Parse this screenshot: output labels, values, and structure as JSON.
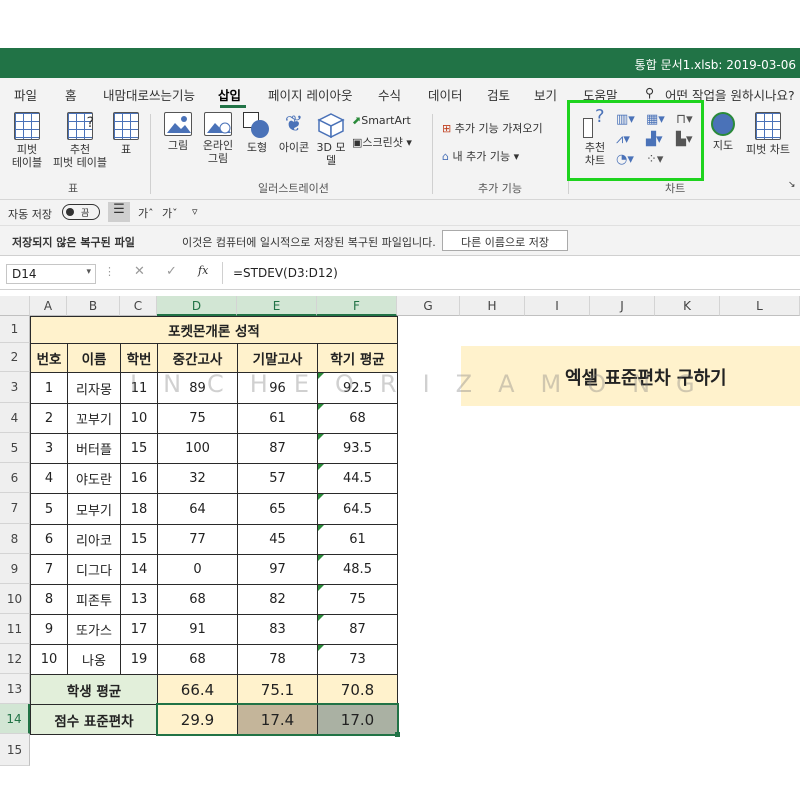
{
  "window": {
    "title": "통합 문서1.xlsb: 2019-03-06"
  },
  "menu": {
    "tabs": [
      "파일",
      "홈",
      "내맘대로쓰는기능",
      "삽입",
      "페이지 레이아웃",
      "수식",
      "데이터",
      "검토",
      "보기",
      "도움말"
    ],
    "active": "삽입",
    "search": "어떤 작업을 원하시나요?"
  },
  "ribbon": {
    "tables": {
      "pivot": "피벗\n테이블",
      "recommended_pivot": "추천\n피벗 테이블",
      "table": "표",
      "group": "표"
    },
    "illustrations": {
      "picture": "그림",
      "online_picture": "온라인\n그림",
      "shapes": "도형",
      "icons": "아이콘",
      "models3d": "3D 모\n델",
      "smartart": "SmartArt",
      "screenshot": "스크린샷",
      "group": "일러스트레이션"
    },
    "addins": {
      "get": "추가 기능 가져오기",
      "my": "내 추가 기능",
      "group": "추가 기능"
    },
    "charts": {
      "recommended": "추천\n차트",
      "map": "지도",
      "pivot_chart": "피벗 차트",
      "group": "차트"
    }
  },
  "qat": {
    "autosave": "자동 저장",
    "toggle": "끔"
  },
  "recovery": {
    "title": "저장되지 않은 복구된 파일",
    "message": "이것은 컴퓨터에 일시적으로 저장된 복구된 파일입니다.",
    "button": "다른 이름으로 저장"
  },
  "formula_bar": {
    "name_box": "D14",
    "fx": "fx",
    "formula": "=STDEV(D3:D12)"
  },
  "columns": [
    "A",
    "B",
    "C",
    "D",
    "E",
    "F",
    "G",
    "H",
    "I",
    "J",
    "K",
    "L"
  ],
  "rows": [
    "1",
    "2",
    "3",
    "4",
    "5",
    "6",
    "7",
    "8",
    "9",
    "10",
    "11",
    "12",
    "13",
    "14",
    "15"
  ],
  "sheet": {
    "title": "포켓몬개론 성적",
    "headers": [
      "번호",
      "이름",
      "학번",
      "중간고사",
      "기말고사",
      "학기 평균"
    ],
    "data": [
      [
        "1",
        "리자몽",
        "11",
        "89",
        "96",
        "92.5"
      ],
      [
        "2",
        "꼬부기",
        "10",
        "75",
        "61",
        "68"
      ],
      [
        "3",
        "버터플",
        "15",
        "100",
        "87",
        "93.5"
      ],
      [
        "4",
        "야도란",
        "16",
        "32",
        "57",
        "44.5"
      ],
      [
        "5",
        "모부기",
        "18",
        "64",
        "65",
        "64.5"
      ],
      [
        "6",
        "리아코",
        "15",
        "77",
        "45",
        "61"
      ],
      [
        "7",
        "디그다",
        "14",
        "0",
        "97",
        "48.5"
      ],
      [
        "8",
        "피존투",
        "13",
        "68",
        "82",
        "75"
      ],
      [
        "9",
        "또가스",
        "17",
        "91",
        "83",
        "87"
      ],
      [
        "10",
        "나옹",
        "19",
        "68",
        "78",
        "73"
      ]
    ],
    "avg_label": "학생 평균",
    "avg": [
      "66.4",
      "75.1",
      "70.8"
    ],
    "std_label": "점수 표준편차",
    "std": [
      "29.9",
      "17.4",
      "17.0"
    ]
  },
  "banner": {
    "text": "엑셀 표준편차 구하기"
  },
  "watermark": "INCHEORIZAMONG",
  "colors": {
    "excel_green": "#217346",
    "highlight": "#1ed31e",
    "title_fill": "#fff2cc",
    "avg_fill": "#e2efda",
    "std_e_fill": "#c4b59a",
    "std_f_fill": "#aab1a3"
  }
}
